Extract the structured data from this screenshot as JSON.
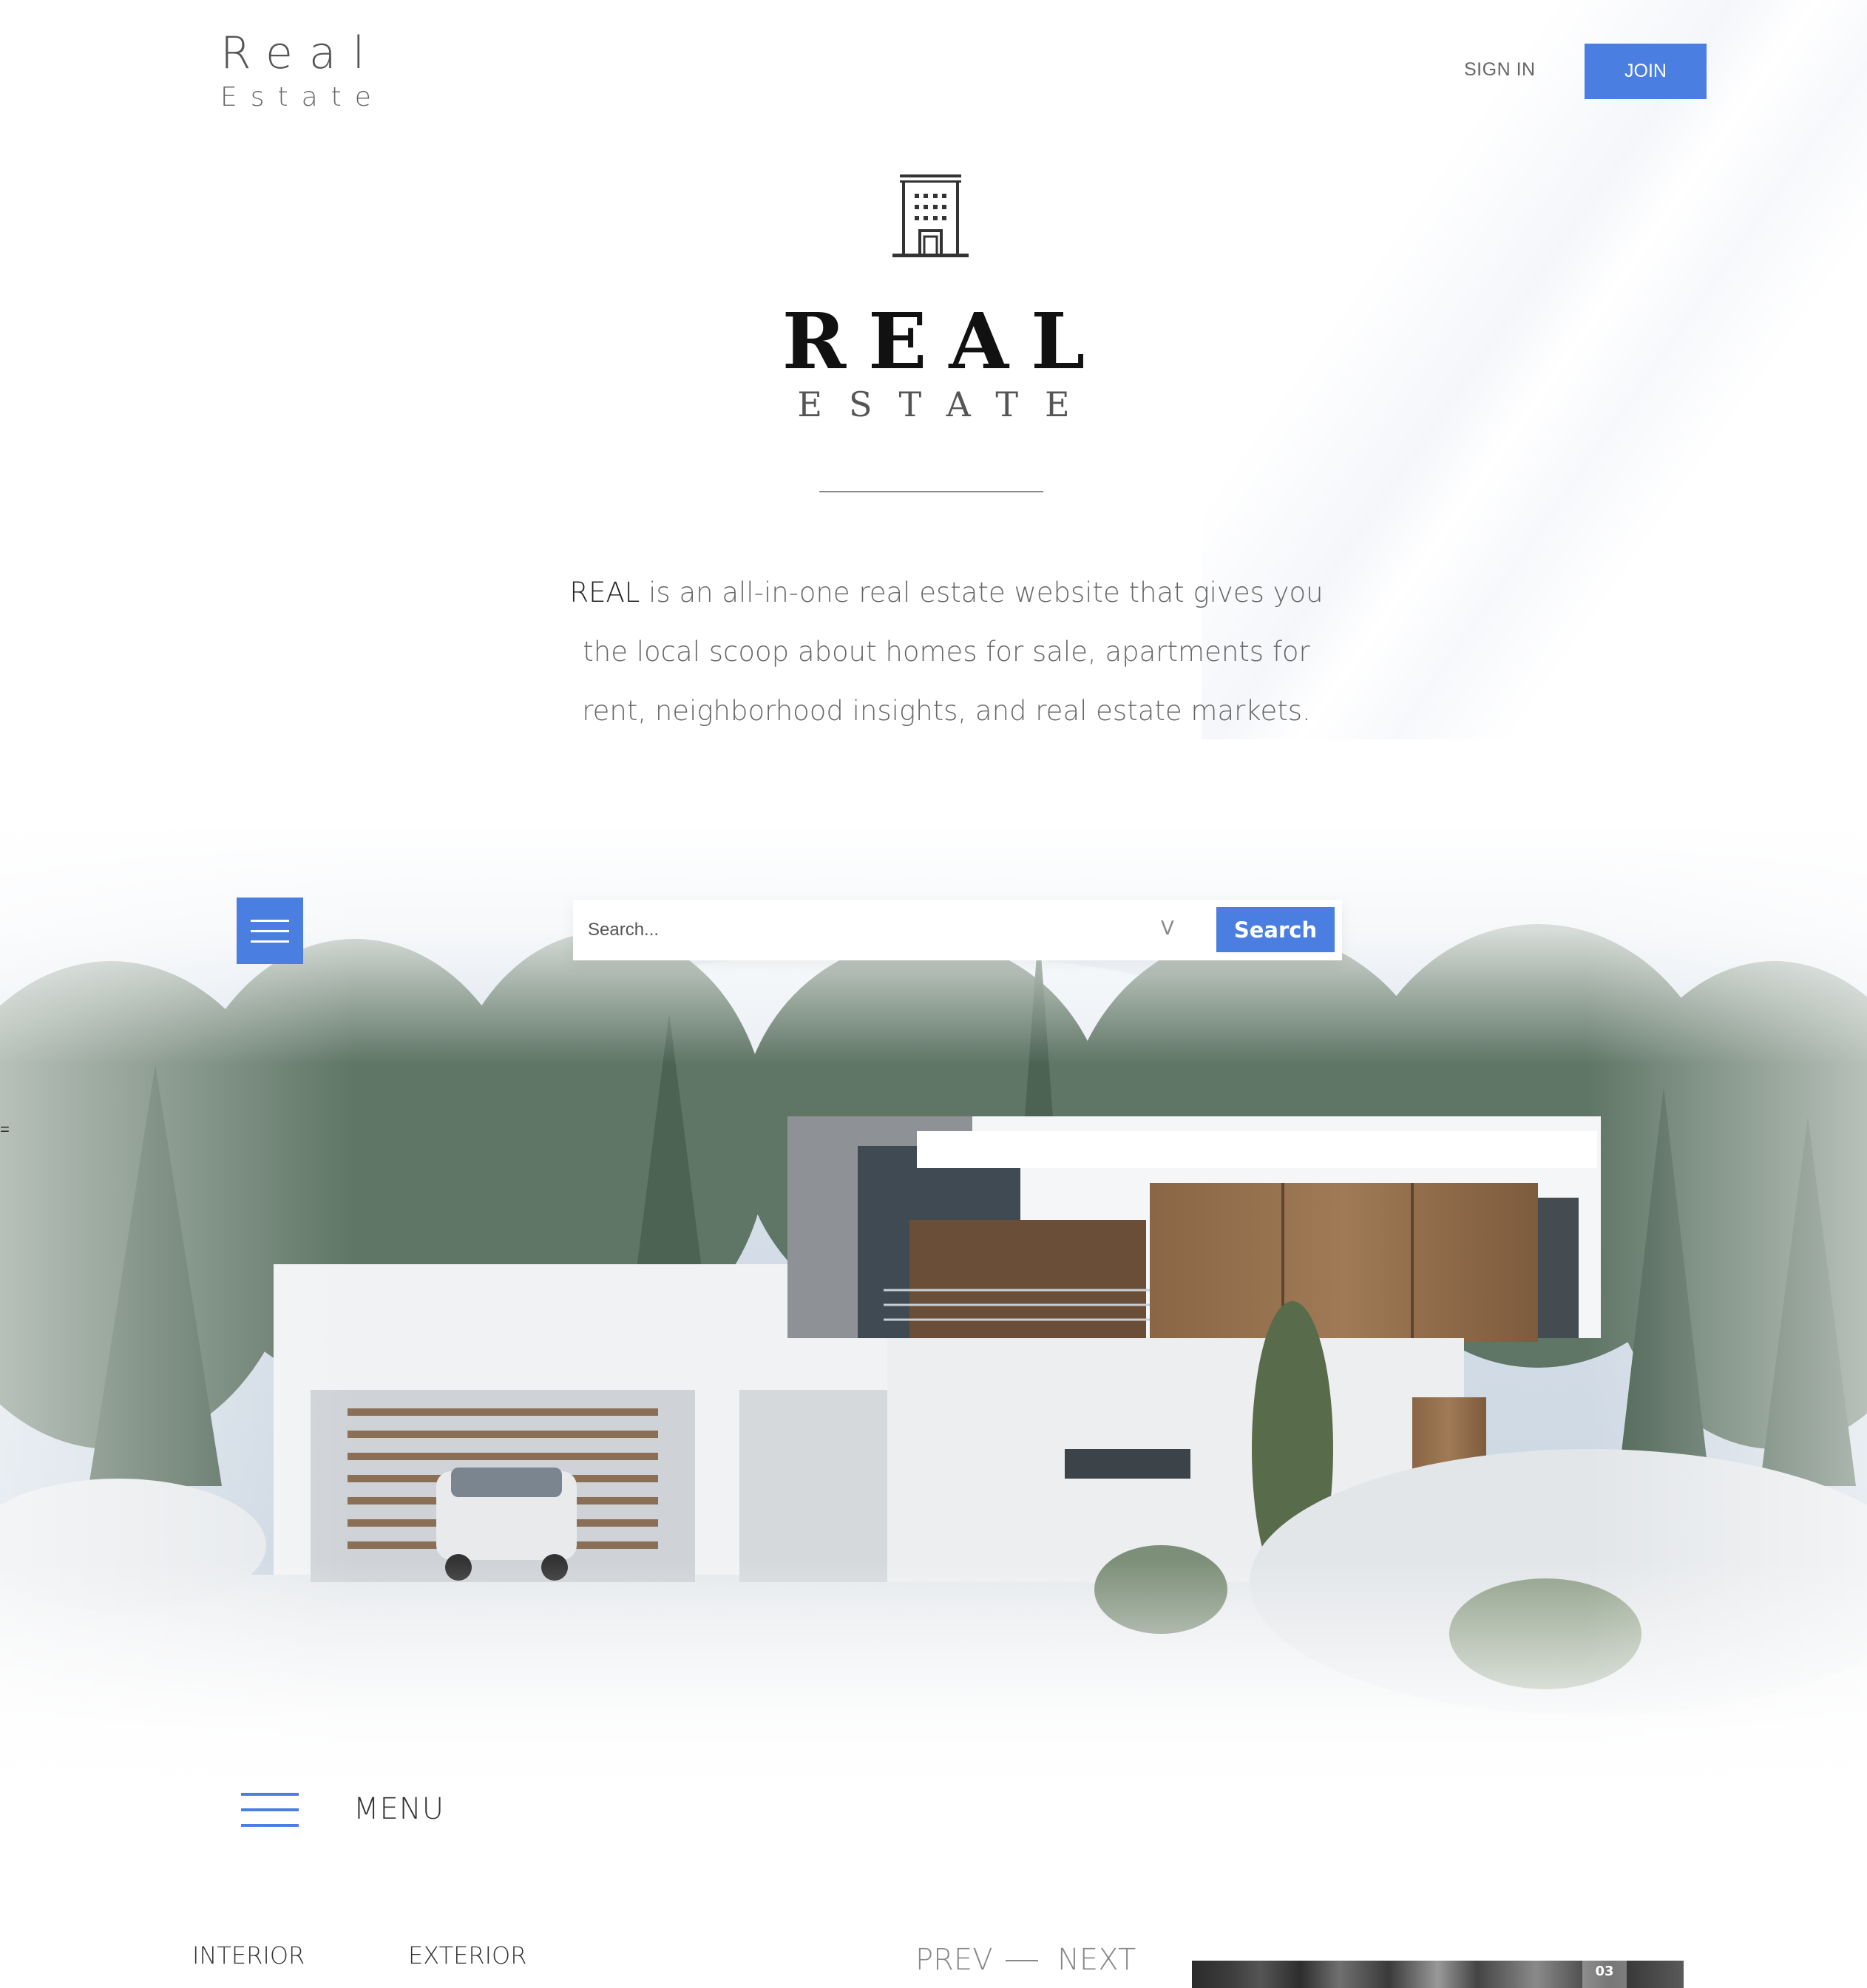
{
  "header": {
    "brand_line1": "Real",
    "brand_line2": "Estate",
    "signin_label": "SIGN IN",
    "join_label": "JOIN"
  },
  "hero": {
    "icon": "building-icon",
    "logo_title": "REAL",
    "logo_subtitle": "ESTATE",
    "tagline_emphasis": "REAL",
    "tagline_rest": " is an all-in-one real estate website that gives you the local scoop about homes for sale, apartments for rent, neighborhood insights, and real estate markets."
  },
  "search": {
    "placeholder": "Search...",
    "dropdown_glyph": "V",
    "button_label": "Search"
  },
  "side_marker": "=",
  "menu": {
    "label": "MENU",
    "icon": "hamburger-icon"
  },
  "gallery": {
    "tabs": [
      "INTERIOR",
      "EXTERIOR"
    ],
    "prev_label": "PREV",
    "next_label": "NEXT",
    "thumb_badge": "03"
  },
  "colors": {
    "accent": "#4a7ee0",
    "text_dark": "#222222",
    "text_muted": "#666666"
  }
}
